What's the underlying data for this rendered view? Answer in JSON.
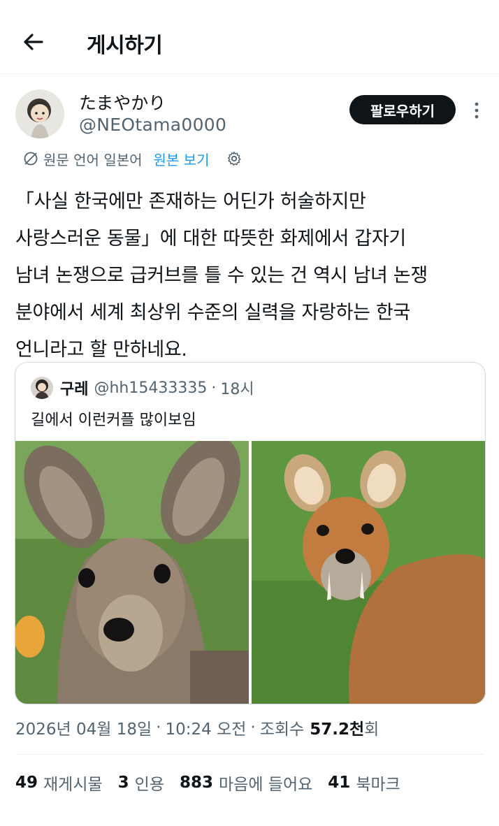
{
  "header": {
    "title": "게시하기",
    "back_icon": "arrow-left-icon"
  },
  "author": {
    "display_name": "たまやかり",
    "handle": "@NEOtama0000",
    "follow_label": "팔로우하기",
    "more_icon": "more-vertical-icon"
  },
  "translation": {
    "original_language": "원문 언어 일본어",
    "show_original": "원본 보기"
  },
  "tweet": {
    "lines": [
      "「사실 한국에만 존재하는 어딘가 허술하지만",
      "사랑스러운 동물」에 대한 따뜻한 화제에서 갑자기",
      "남녀 논쟁으로 급커브를 틀 수 있는 건 역시 남녀 논쟁",
      "분야에서 세계 최상위 수준의 실력을 자랑하는 한국",
      "언니라고 할 만하네요."
    ]
  },
  "quote": {
    "name": "구레",
    "handle": "@hh15433335",
    "dot": "·",
    "time": "18시",
    "text": "길에서 이런커플 많이보임"
  },
  "meta": {
    "date": "2026년 04월 18일",
    "sep1": "·",
    "time": "10:24 오전",
    "sep2": "·",
    "views_label": "조회수",
    "views_num": "57.2천",
    "views_suffix": "회"
  },
  "stats": {
    "reposts_num": "49",
    "reposts_label": "재게시물",
    "quotes_num": "3",
    "quotes_label": "인용",
    "likes_num": "883",
    "likes_label": "마음에 들어요",
    "bookmarks_num": "41",
    "bookmarks_label": "북마크"
  },
  "colors": {
    "accent": "#1d9bf0",
    "secondary_text": "#536471",
    "primary_text": "#0f1419",
    "border": "#cfd9de"
  }
}
